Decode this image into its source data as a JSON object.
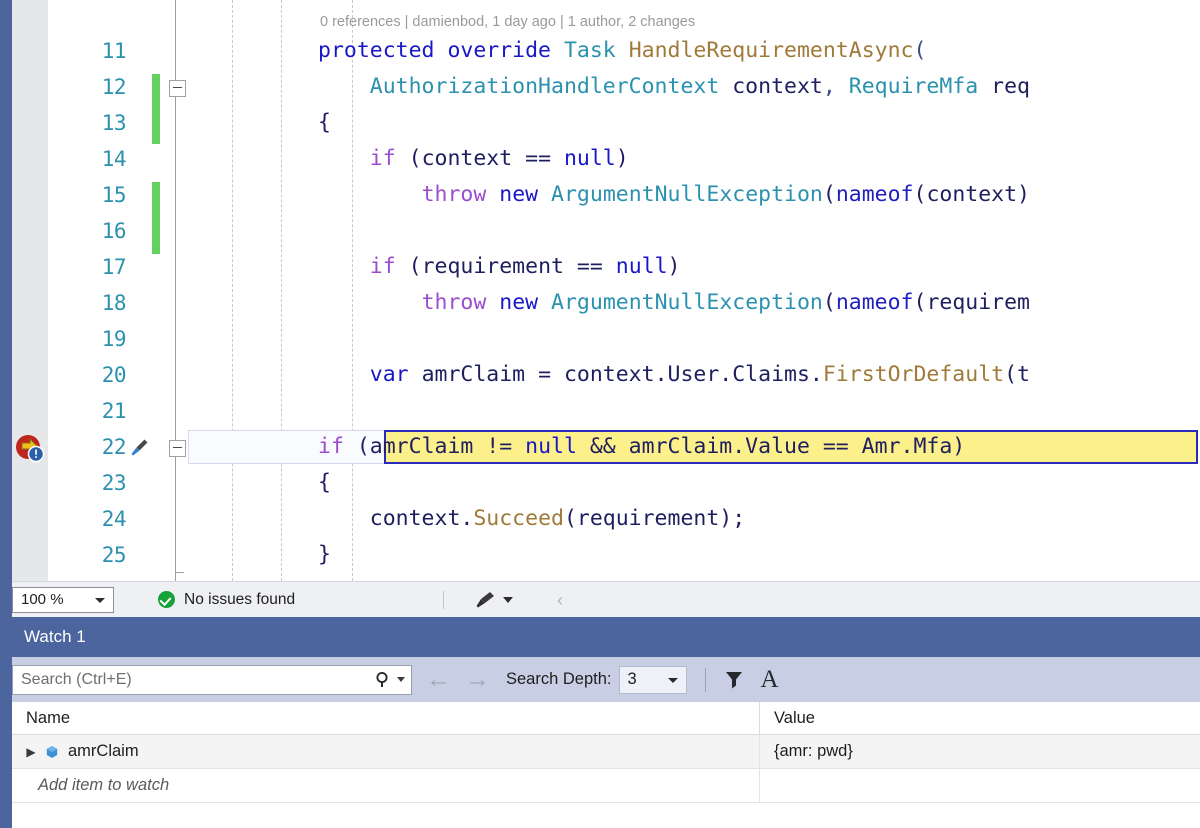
{
  "editor": {
    "codelens": "0 references | damienbod, 1 day ago | 1 author, 2 changes",
    "zoom_level": "100 %",
    "lines": [
      {
        "num": "11",
        "text": "protected override Task HandleRequirementAsync("
      },
      {
        "num": "12",
        "text": "    AuthorizationHandlerContext context, RequireMfa req"
      },
      {
        "num": "13",
        "text": "{"
      },
      {
        "num": "14",
        "text": "    if (context == null)"
      },
      {
        "num": "15",
        "text": "        throw new ArgumentNullException(nameof(context)"
      },
      {
        "num": "16",
        "text": ""
      },
      {
        "num": "17",
        "text": "    if (requirement == null)"
      },
      {
        "num": "18",
        "text": "        throw new ArgumentNullException(nameof(requirem"
      },
      {
        "num": "19",
        "text": ""
      },
      {
        "num": "20",
        "text": "    var amrClaim = context.User.Claims.FirstOrDefault(t"
      },
      {
        "num": "21",
        "text": ""
      },
      {
        "num": "22",
        "text": "if (amrClaim != null && amrClaim.Value == Amr.Mfa)"
      },
      {
        "num": "23",
        "text": "{"
      },
      {
        "num": "24",
        "text": "    context.Succeed(requirement);"
      },
      {
        "num": "25",
        "text": "}"
      }
    ],
    "current_statement_line": "22",
    "current_statement_text": "if (amrClaim != null && amrClaim.Value == Amr.Mfa)",
    "colors": {
      "keyword_purple": "#9b4ecb",
      "keyword_blue": "#1818c8",
      "type_teal": "#2b91af",
      "method_tan": "#9f7a38",
      "line_number": "#2b91af",
      "current_statement_bg": "#fbf08a",
      "current_statement_border": "#2b2bbb",
      "changebar_green": "#62d160",
      "accent_blue": "#4c659f"
    }
  },
  "statusbar": {
    "zoom_value": "100 %",
    "issues_text": "No issues found",
    "issues_icon": "check-circle-icon",
    "brush_icon": "paintbrush-icon",
    "collapse_chevron": "‹"
  },
  "watch": {
    "tab_label": "Watch 1",
    "search_placeholder": "Search (Ctrl+E)",
    "search_value": "",
    "search_icon": "magnifier-icon",
    "back_arrow": "←",
    "forward_arrow": "→",
    "depth_label": "Search Depth:",
    "depth_value": "3",
    "filter_icon": "funnel-icon",
    "sort_icon": "A",
    "columns": {
      "name": "Name",
      "value": "Value"
    },
    "rows": [
      {
        "name": "amrClaim",
        "value": "{amr: pwd}",
        "icon": "hexagon-icon",
        "expander": "▶"
      }
    ],
    "add_item_placeholder": "Add item to watch"
  }
}
